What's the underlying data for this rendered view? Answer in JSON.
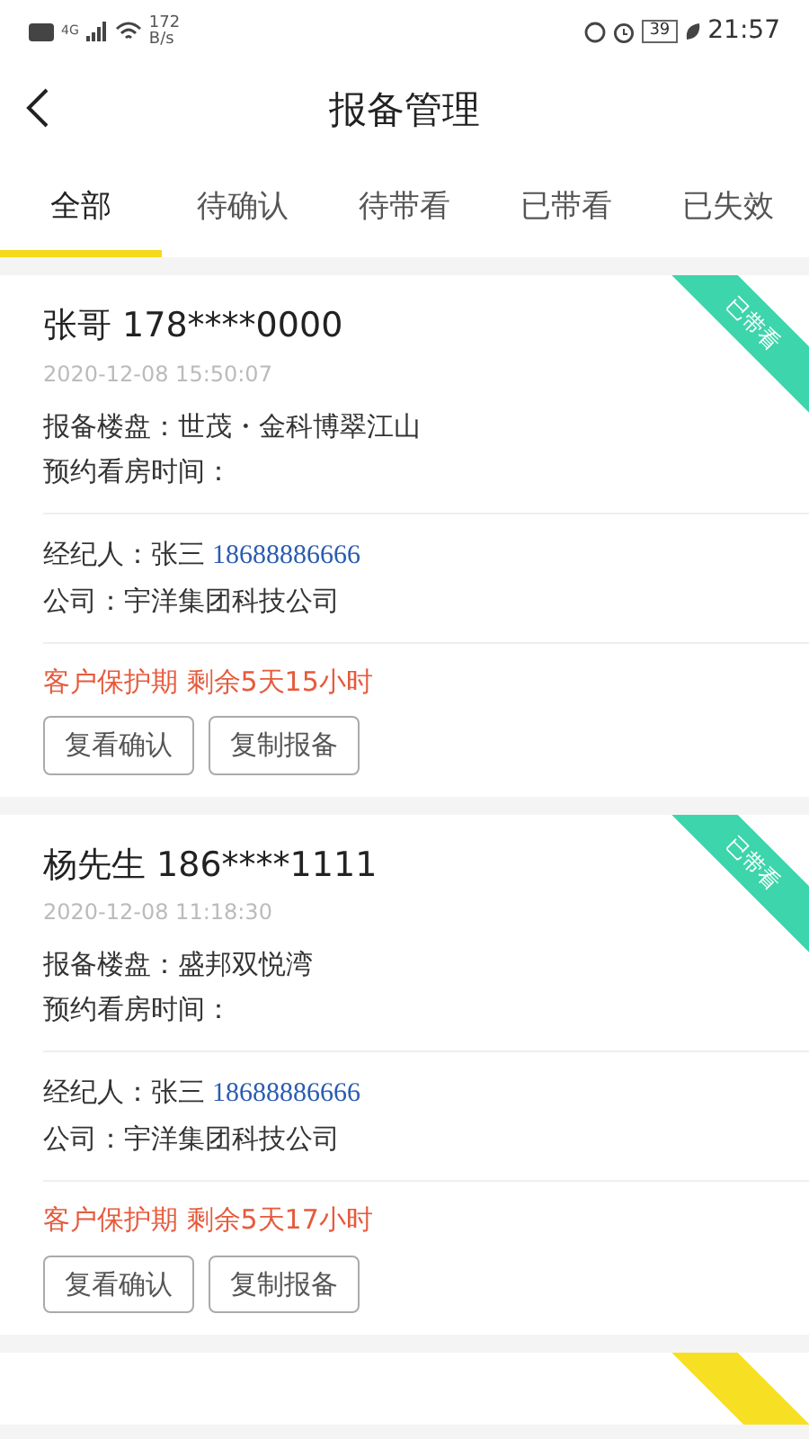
{
  "status_bar": {
    "network_type": "4G",
    "speed_value": "172",
    "speed_unit": "B/s",
    "battery": "39",
    "time": "21:57"
  },
  "header": {
    "title": "报备管理"
  },
  "tabs": [
    {
      "label": "全部",
      "selected": true
    },
    {
      "label": "待确认",
      "selected": false
    },
    {
      "label": "待带看",
      "selected": false
    },
    {
      "label": "已带看",
      "selected": false
    },
    {
      "label": "已失效",
      "selected": false
    }
  ],
  "reports": [
    {
      "ribbon": {
        "label": "已带看",
        "color": "#3dd5ab"
      },
      "customer": "张哥 178****0000",
      "time": "2020-12-08 15:50:07",
      "property": "报备楼盘：世茂・金科博翠江山",
      "appointment": "预约看房时间：",
      "agent": "经纪人：张三",
      "agent_phone": "18688886666",
      "company": "公司：宇洋集团科技公司",
      "protection": "客户保护期 剩余5天15小时",
      "buttons": [
        "复看确认",
        "复制报备"
      ]
    },
    {
      "ribbon": {
        "label": "已带看",
        "color": "#3dd5ab"
      },
      "customer": "杨先生 186****1111",
      "time": "2020-12-08 11:18:30",
      "property": "报备楼盘：盛邦双悦湾",
      "appointment": "预约看房时间：",
      "agent": "经纪人：张三",
      "agent_phone": "18688886666",
      "company": "公司：宇洋集团科技公司",
      "protection": "客户保护期 剩余5天17小时",
      "buttons": [
        "复看确认",
        "复制报备"
      ]
    },
    {
      "ribbon": {
        "color": "#f7e024"
      }
    }
  ]
}
